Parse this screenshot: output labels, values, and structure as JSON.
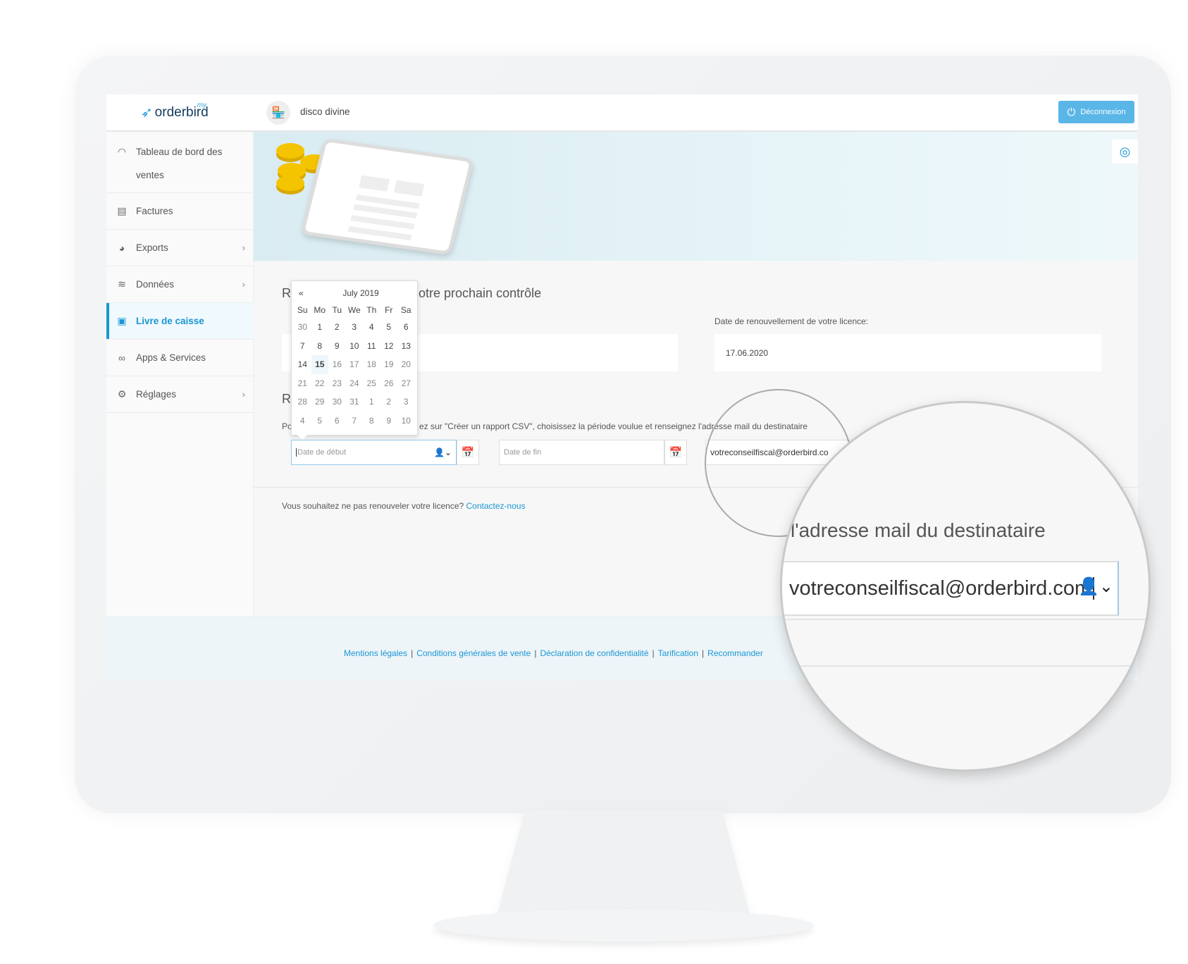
{
  "app": {
    "logo": "orderbird",
    "logo_prefix": "my.",
    "shop_name": "disco divine",
    "logout_label": "Déconnexion"
  },
  "sidebar": {
    "items": [
      {
        "label": "Tableau de bord des ventes",
        "icon": "gauge-icon"
      },
      {
        "label": "Factures",
        "icon": "invoice-icon"
      },
      {
        "label": "Exports",
        "icon": "export-icon",
        "chevron": true
      },
      {
        "label": "Données",
        "icon": "layers-icon",
        "chevron": true
      },
      {
        "label": "Livre de caisse",
        "icon": "cashbook-icon",
        "active": true
      },
      {
        "label": "Apps & Services",
        "icon": "rings-icon"
      },
      {
        "label": "Réglages",
        "icon": "gear-icon",
        "chevron": true
      }
    ]
  },
  "main": {
    "heading1_start": "Re",
    "heading1_end": "otre prochain contrôle",
    "renewal_label": "Date de renouvellement de votre licence:",
    "renewal_value": "17.06.2020",
    "heading2_start": "Ra",
    "instructions_start": "Po",
    "instructions_end": "ez sur \"Créer un rapport CSV\", choisissez la période voulue et renseignez l'adresse mail du destinataire",
    "start_date_placeholder": "Date de début",
    "end_date_placeholder": "Date de fin",
    "email_value": "votreconseilfiscal@orderbird.co",
    "no_renew_text": "Vous souhaitez ne pas renouveler votre licence?",
    "contact_link": "Contactez-nous"
  },
  "calendar": {
    "prev": "«",
    "month": "July 2019",
    "weekdays": [
      "Su",
      "Mo",
      "Tu",
      "We",
      "Th",
      "Fr",
      "Sa"
    ],
    "weeks": [
      [
        "30",
        "1",
        "2",
        "3",
        "4",
        "5",
        "6"
      ],
      [
        "7",
        "8",
        "9",
        "10",
        "11",
        "12",
        "13"
      ],
      [
        "14",
        "15",
        "16",
        "17",
        "18",
        "19",
        "20"
      ],
      [
        "21",
        "22",
        "23",
        "24",
        "25",
        "26",
        "27"
      ],
      [
        "28",
        "29",
        "30",
        "31",
        "1",
        "2",
        "3"
      ],
      [
        "4",
        "5",
        "6",
        "7",
        "8",
        "9",
        "10"
      ]
    ],
    "today": "15"
  },
  "footer": {
    "links": [
      "Mentions légales",
      "Conditions générales de vente",
      "Déclaration de confidentialité",
      "Tarification",
      "Recommander"
    ]
  },
  "magnifier": {
    "label": "l'adresse mail du destinataire",
    "email": "votreconseilfiscal@orderbird.com"
  },
  "colors": {
    "accent": "#1a96d4",
    "logout_bg": "#5bb6e8",
    "banner": "#dcedf2"
  }
}
